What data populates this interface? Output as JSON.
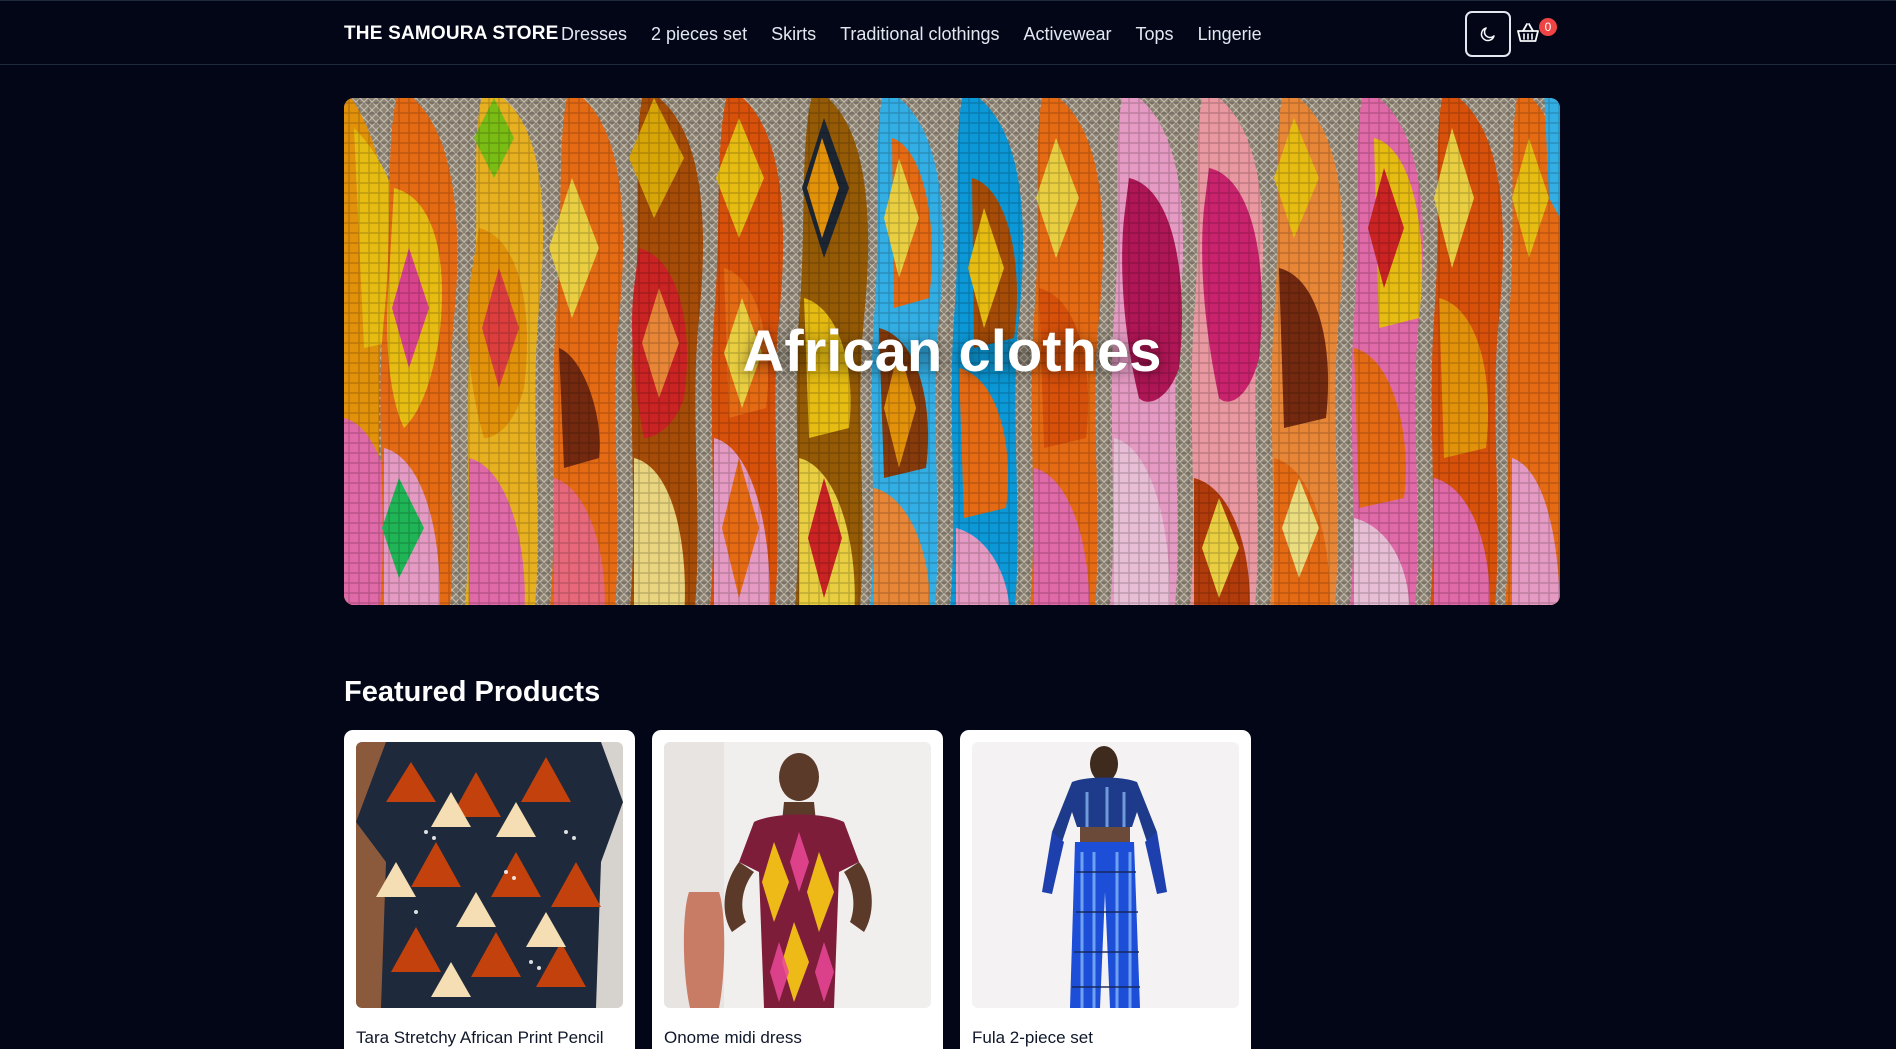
{
  "header": {
    "brand": "THE SAMOURA STORE",
    "nav": [
      "Dresses",
      "2 pieces set",
      "Skirts",
      "Traditional clothings",
      "Activewear",
      "Tops",
      "Lingerie"
    ],
    "theme_toggle_icon": "moon-icon",
    "cart_icon": "basket-icon",
    "cart_count": "0"
  },
  "hero": {
    "title": "African clothes",
    "image_icon": "woven-sandals-image"
  },
  "featured": {
    "title": "Featured Products",
    "products": [
      {
        "name": "Tara Stretchy African Print Pencil",
        "image": "print-top-image"
      },
      {
        "name": "Onome midi dress",
        "image": "model-dress-image"
      },
      {
        "name": "Fula 2-piece set",
        "image": "blue-set-image"
      }
    ]
  },
  "colors": {
    "background": "#020617",
    "text": "#f8fafc",
    "badge": "#ef4444",
    "card": "#ffffff"
  }
}
